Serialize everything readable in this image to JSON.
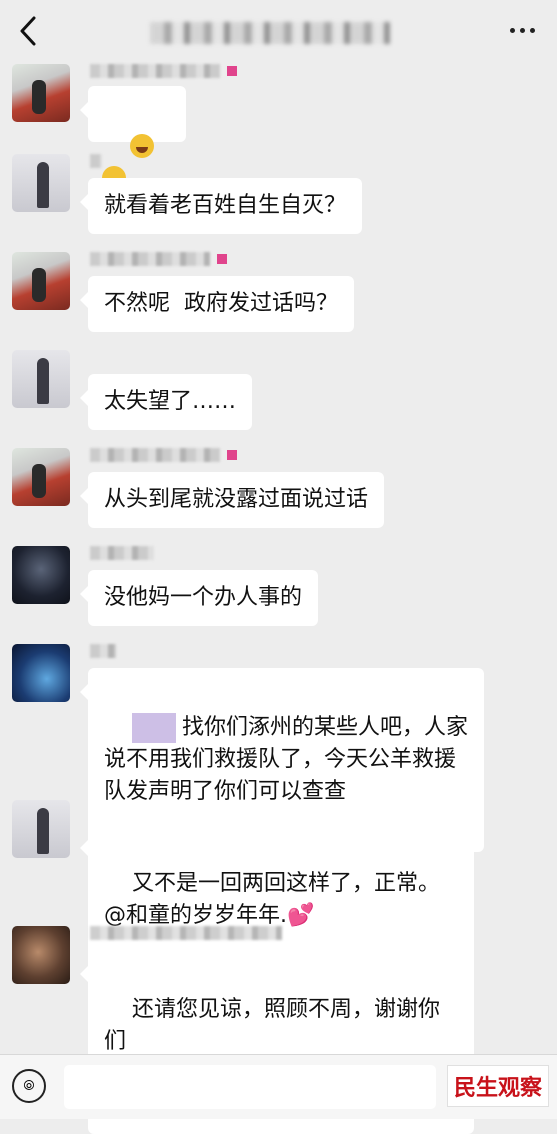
{
  "header": {
    "back_icon": "chevron-left-icon",
    "more_icon": "more-dots-icon"
  },
  "messages": [
    {
      "avatar": "av-red",
      "bubble": ""
    },
    {
      "avatar": "av-grey",
      "bubble": "就看着老百姓自生自灭？"
    },
    {
      "avatar": "av-red",
      "bubble": "不然呢  政府发过话吗？"
    },
    {
      "avatar": "av-grey",
      "bubble": "太失望了……"
    },
    {
      "avatar": "av-red",
      "bubble": "从头到尾就没露过面说过话"
    },
    {
      "avatar": "av-night",
      "bubble": "没他妈一个办人事的"
    },
    {
      "avatar": "av-blue",
      "bubble": "找你们涿州的某些人吧，人家说不用我们救援队了，今天公羊救援队发声明了你们可以查查"
    },
    {
      "avatar": "av-grey",
      "bubble": "又不是一回两回这样了，正常。@和童的岁岁年年."
    },
    {
      "avatar": "av-brown",
      "bubble": "还请您见谅，照顾不周，谢谢你们"
    }
  ],
  "footer": {
    "voice_icon": "voice-icon",
    "watermark": "民生观察"
  }
}
